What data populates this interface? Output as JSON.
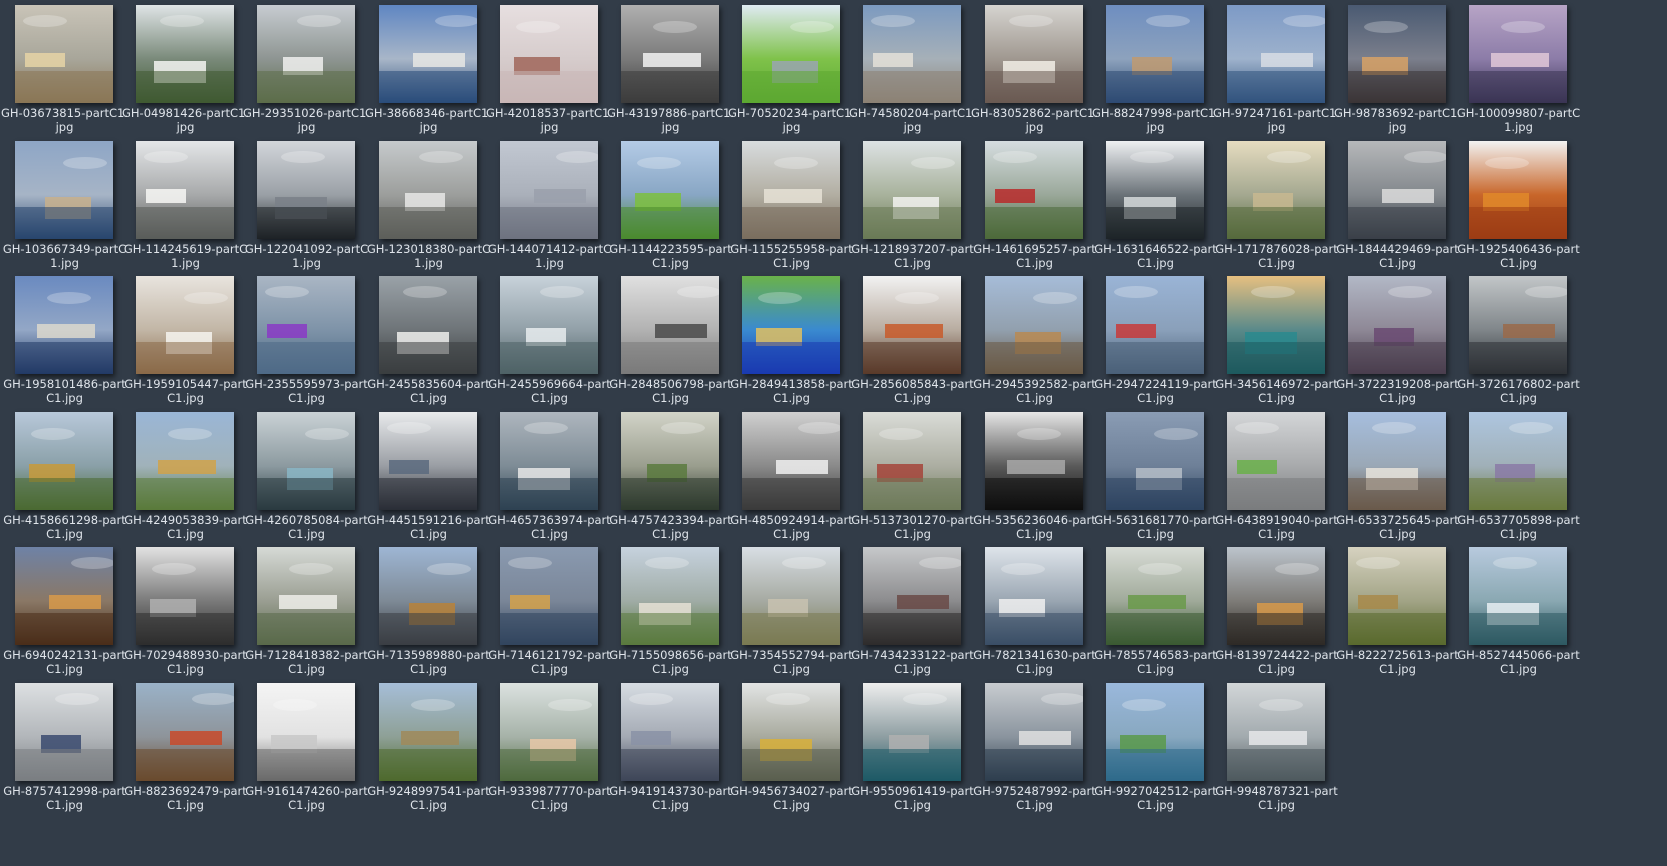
{
  "window": {
    "view": "thumbnail-grid"
  },
  "files": [
    {
      "name": "GH-03673815-partC1.jpg",
      "icon": "image-thumbnail",
      "sky": "#c9c4b8",
      "ground": "#8a7656",
      "accent": "#e6d3a6",
      "mid": "#a8a69a"
    },
    {
      "name": "GH-04981426-partC1.jpg",
      "icon": "image-thumbnail",
      "sky": "#dfe4e6",
      "ground": "#3f5a32",
      "accent": "#f4f4f2",
      "mid": "#7a8a7a"
    },
    {
      "name": "GH-29351026-partC1.jpg",
      "icon": "image-thumbnail",
      "sky": "#c7ccd1",
      "ground": "#5c6d4a",
      "accent": "#f0f0ee",
      "mid": "#8e9592"
    },
    {
      "name": "GH-38668346-partC1.jpg",
      "icon": "image-thumbnail",
      "sky": "#5f86c2",
      "ground": "#2a4c7a",
      "accent": "#e8e8e4",
      "mid": "#a8b6c8"
    },
    {
      "name": "GH-42018537-partC1.jpg",
      "icon": "image-thumbnail",
      "sky": "#e7dfe0",
      "ground": "#c9b7b6",
      "accent": "#a0665a",
      "mid": "#d6cccc"
    },
    {
      "name": "GH-43197886-partC1.jpg",
      "icon": "image-thumbnail",
      "sky": "#b0b0b0",
      "ground": "#3c3c3c",
      "accent": "#f2f2f2",
      "mid": "#7a7a7a"
    },
    {
      "name": "GH-70520234-partC1.jpg",
      "icon": "image-thumbnail",
      "sky": "#dfeaf2",
      "ground": "#5ca832",
      "accent": "#9aa4b2",
      "mid": "#7fc24a"
    },
    {
      "name": "GH-74580204-partC1.jpg",
      "icon": "image-thumbnail",
      "sky": "#7c9ac0",
      "ground": "#8c8274",
      "accent": "#e4e0d8",
      "mid": "#a6b0b8"
    },
    {
      "name": "GH-83052862-partC1.jpg",
      "icon": "image-thumbnail",
      "sky": "#d6d4d0",
      "ground": "#6a5a52",
      "accent": "#f2eee6",
      "mid": "#a09890"
    },
    {
      "name": "GH-88247998-partC1.jpg",
      "icon": "image-thumbnail",
      "sky": "#6e8ec0",
      "ground": "#2e4a72",
      "accent": "#c09a70",
      "mid": "#8da2bd"
    },
    {
      "name": "GH-97247161-partC1.jpg",
      "icon": "image-thumbnail",
      "sky": "#7d9ac6",
      "ground": "#32537e",
      "accent": "#d8dde4",
      "mid": "#9eb2cc"
    },
    {
      "name": "GH-98783692-partC1.jpg",
      "icon": "image-thumbnail",
      "sky": "#4a5a72",
      "ground": "#3b3436",
      "accent": "#d8a266",
      "mid": "#7b7f8c"
    },
    {
      "name": "GH-100099807-partC1.jpg",
      "icon": "image-thumbnail",
      "sky": "#b7a4c6",
      "ground": "#3a3454",
      "accent": "#e2c8d8",
      "mid": "#8c7ca8"
    },
    {
      "name": "GH-103667349-partC1.jpg",
      "icon": "image-thumbnail",
      "sky": "#8ea6c6",
      "ground": "#28466e",
      "accent": "#c8b08c",
      "mid": "#a6b4c6"
    },
    {
      "name": "GH-114245619-partC1.jpg",
      "icon": "image-thumbnail",
      "sky": "#e4e6e8",
      "ground": "#5a5c5a",
      "accent": "#f7f7f5",
      "mid": "#a7a9aa"
    },
    {
      "name": "GH-122041092-partC1.jpg",
      "icon": "image-thumbnail",
      "sky": "#d2d6da",
      "ground": "#1e2226",
      "accent": "#7a8088",
      "mid": "#9aa0a6"
    },
    {
      "name": "GH-123018380-partC1.jpg",
      "icon": "image-thumbnail",
      "sky": "#c6cacc",
      "ground": "#5c5e5a",
      "accent": "#e8e8e6",
      "mid": "#9c9e9c"
    },
    {
      "name": "GH-144071412-partC1.jpg",
      "icon": "image-thumbnail",
      "sky": "#c2c8d2",
      "ground": "#6e7280",
      "accent": "#9aa0ac",
      "mid": "#aab0ba"
    },
    {
      "name": "GH-1144223595-partC1.jpg",
      "icon": "image-thumbnail",
      "sky": "#b4cbe6",
      "ground": "#4a8a2e",
      "accent": "#7cbf3e",
      "mid": "#88a6c4"
    },
    {
      "name": "GH-1155255958-partC1.jpg",
      "icon": "image-thumbnail",
      "sky": "#d8dcde",
      "ground": "#7a6e5e",
      "accent": "#e6e2d6",
      "mid": "#b2aea2"
    },
    {
      "name": "GH-1218937207-partC1.jpg",
      "icon": "image-thumbnail",
      "sky": "#dde2e4",
      "ground": "#6a7a56",
      "accent": "#f2f2f0",
      "mid": "#a8b29c"
    },
    {
      "name": "GH-1461695257-partC1.jpg",
      "icon": "image-thumbnail",
      "sky": "#d6dde0",
      "ground": "#4d6a3a",
      "accent": "#b82a2a",
      "mid": "#9aa89a"
    },
    {
      "name": "GH-1631646522-partC1.jpg",
      "icon": "image-thumbnail",
      "sky": "#eef0f2",
      "ground": "#1e2428",
      "accent": "#d6dadc",
      "mid": "#6a7278"
    },
    {
      "name": "GH-1717876028-partC1.jpg",
      "icon": "image-thumbnail",
      "sky": "#e6dcc0",
      "ground": "#556a3c",
      "accent": "#c8b890",
      "mid": "#a4a890"
    },
    {
      "name": "GH-1844429469-partC1.jpg",
      "icon": "image-thumbnail",
      "sky": "#b6b8ba",
      "ground": "#3a4048",
      "accent": "#dcdcdc",
      "mid": "#82878c"
    },
    {
      "name": "GH-1925406436-partC1.jpg",
      "icon": "image-thumbnail",
      "sky": "#f2f2f2",
      "ground": "#9c3c14",
      "accent": "#e08a2a",
      "mid": "#c8662a"
    },
    {
      "name": "GH-1958101486-partC1.jpg",
      "icon": "image-thumbnail",
      "sky": "#6a8ac0",
      "ground": "#223a66",
      "accent": "#dcd8cc",
      "mid": "#93a7c6"
    },
    {
      "name": "GH-1959105447-partC1.jpg",
      "icon": "image-thumbnail",
      "sky": "#e8e4de",
      "ground": "#8a6a48",
      "accent": "#f6f4f0",
      "mid": "#c2b6a6"
    },
    {
      "name": "GH-2355595973-partC1.jpg",
      "icon": "image-thumbnail",
      "sky": "#aab6c4",
      "ground": "#4e6a86",
      "accent": "#8a3ac6",
      "mid": "#7e93a8"
    },
    {
      "name": "GH-2455835604-partC1.jpg",
      "icon": "image-thumbnail",
      "sky": "#9aa2a8",
      "ground": "#3a3e40",
      "accent": "#eeeeec",
      "mid": "#6e7478"
    },
    {
      "name": "GH-2455969664-partC1.jpg",
      "icon": "image-thumbnail",
      "sky": "#c8d2da",
      "ground": "#4e6266",
      "accent": "#e8ecee",
      "mid": "#92a0a8"
    },
    {
      "name": "GH-2848506798-partC1.jpg",
      "icon": "image-thumbnail",
      "sky": "#e0e0e0",
      "ground": "#7a7a7a",
      "accent": "#4a4a4a",
      "mid": "#b2b2b2"
    },
    {
      "name": "GH-2849413858-partC1.jpg",
      "icon": "image-thumbnail",
      "sky": "#6ab24a",
      "ground": "#1a3ab0",
      "accent": "#e0c060",
      "mid": "#3a8ad0"
    },
    {
      "name": "GH-2856085843-partC1.jpg",
      "icon": "image-thumbnail",
      "sky": "#f2f2f2",
      "ground": "#5a3a2a",
      "accent": "#c85a2a",
      "mid": "#b8aca0"
    },
    {
      "name": "GH-2945392582-partC1.jpg",
      "icon": "image-thumbnail",
      "sky": "#a6bcd8",
      "ground": "#6a5a46",
      "accent": "#b88a52",
      "mid": "#92a0ae"
    },
    {
      "name": "GH-2947224119-partC1.jpg",
      "icon": "image-thumbnail",
      "sky": "#9ab4d6",
      "ground": "#4a6078",
      "accent": "#c83a3a",
      "mid": "#8aa0ba"
    },
    {
      "name": "GH-3456146972-partC1.jpg",
      "icon": "image-thumbnail",
      "sky": "#e6c080",
      "ground": "#1e5a5e",
      "accent": "#2a8a8e",
      "mid": "#5a8a8a"
    },
    {
      "name": "GH-3722319208-partC1.jpg",
      "icon": "image-thumbnail",
      "sky": "#b2b8c6",
      "ground": "#4a3e4e",
      "accent": "#6a4a72",
      "mid": "#8e8896"
    },
    {
      "name": "GH-3726176802-partC1.jpg",
      "icon": "image-thumbnail",
      "sky": "#c2c6c8",
      "ground": "#2e3236",
      "accent": "#9a6a4a",
      "mid": "#80868a"
    },
    {
      "name": "GH-4158661298-partC1.jpg",
      "icon": "image-thumbnail",
      "sky": "#b8c8da",
      "ground": "#4a6a32",
      "accent": "#c89a3a",
      "mid": "#8aa0a8"
    },
    {
      "name": "GH-4249053839-partC1.jpg",
      "icon": "image-thumbnail",
      "sky": "#9ab6d6",
      "ground": "#5a7a3a",
      "accent": "#d0a24a",
      "mid": "#a0b2ba"
    },
    {
      "name": "GH-4260785084-partC1.jpg",
      "icon": "image-thumbnail",
      "sky": "#cad2d6",
      "ground": "#2a3a40",
      "accent": "#8ab6c6",
      "mid": "#8c9aa0"
    },
    {
      "name": "GH-4451591216-partC1.jpg",
      "icon": "image-thumbnail",
      "sky": "#e8eaec",
      "ground": "#2a2e36",
      "accent": "#5a6a7e",
      "mid": "#9a9ea4"
    },
    {
      "name": "GH-4657363974-partC1.jpg",
      "icon": "image-thumbnail",
      "sky": "#aeb6be",
      "ground": "#2e4252",
      "accent": "#e8e8e8",
      "mid": "#7e8c96"
    },
    {
      "name": "GH-4757423394-partC1.jpg",
      "icon": "image-thumbnail",
      "sky": "#d2d4c8",
      "ground": "#2e3a2e",
      "accent": "#5a7a3e",
      "mid": "#9a9e8e"
    },
    {
      "name": "GH-4850924914-partC1.jpg",
      "icon": "image-thumbnail",
      "sky": "#d0d0d0",
      "ground": "#3a3a3a",
      "accent": "#f0f0f0",
      "mid": "#8a8a8a"
    },
    {
      "name": "GH-5137301270-partC1.jpg",
      "icon": "image-thumbnail",
      "sky": "#dadcd8",
      "ground": "#6e7a5a",
      "accent": "#a4443a",
      "mid": "#acaea2"
    },
    {
      "name": "GH-5356236046-partC1.jpg",
      "icon": "image-thumbnail",
      "sky": "#e6e6e6",
      "ground": "#0e0e0e",
      "accent": "#a8a8a8",
      "mid": "#5a5a5a"
    },
    {
      "name": "GH-5631681770-partC1.jpg",
      "icon": "image-thumbnail",
      "sky": "#8a9cb4",
      "ground": "#2e4460",
      "accent": "#b6bec8",
      "mid": "#6e8098"
    },
    {
      "name": "GH-6438919040-partC1.jpg",
      "icon": "image-thumbnail",
      "sky": "#d4d6d8",
      "ground": "#7a7c7e",
      "accent": "#6ab04a",
      "mid": "#a8aaac"
    },
    {
      "name": "GH-6533725645-partC1.jpg",
      "icon": "image-thumbnail",
      "sky": "#a6bede",
      "ground": "#6a5a4a",
      "accent": "#e8e4dc",
      "mid": "#9aa8b6"
    },
    {
      "name": "GH-6537705898-partC1.jpg",
      "icon": "image-thumbnail",
      "sky": "#aec6e0",
      "ground": "#6a7a3e",
      "accent": "#8a7aa6",
      "mid": "#a0b0b8"
    },
    {
      "name": "GH-6940242131-partC1.jpg",
      "icon": "image-thumbnail",
      "sky": "#6e82a6",
      "ground": "#4a2e1a",
      "accent": "#d89a4a",
      "mid": "#8a7866"
    },
    {
      "name": "GH-7029488930-partC1.jpg",
      "icon": "image-thumbnail",
      "sky": "#e2e2e2",
      "ground": "#2e2e2e",
      "accent": "#b0b0b0",
      "mid": "#7a7a7a"
    },
    {
      "name": "GH-7128418382-partC1.jpg",
      "icon": "image-thumbnail",
      "sky": "#d6dad6",
      "ground": "#5a6a4a",
      "accent": "#eeeeea",
      "mid": "#9a9e92"
    },
    {
      "name": "GH-7135989880-partC1.jpg",
      "icon": "image-thumbnail",
      "sky": "#9eb6d4",
      "ground": "#3a3e44",
      "accent": "#b8823a",
      "mid": "#7e8a96"
    },
    {
      "name": "GH-7146121792-partC1.jpg",
      "icon": "image-thumbnail",
      "sky": "#8a9ab0",
      "ground": "#32455e",
      "accent": "#d6a24a",
      "mid": "#7a8698"
    },
    {
      "name": "GH-7155098656-partC1.jpg",
      "icon": "image-thumbnail",
      "sky": "#c6d2de",
      "ground": "#5a7a3e",
      "accent": "#e6e2d6",
      "mid": "#a0aca6"
    },
    {
      "name": "GH-7354552794-partC1.jpg",
      "icon": "image-thumbnail",
      "sky": "#d8dee4",
      "ground": "#7a7a52",
      "accent": "#c8c2b0",
      "mid": "#a6aaa2"
    },
    {
      "name": "GH-7434233122-partC1.jpg",
      "icon": "image-thumbnail",
      "sky": "#c6c8ca",
      "ground": "#2e2c2c",
      "accent": "#6a4a46",
      "mid": "#8c8c8e"
    },
    {
      "name": "GH-7821341630-partC1.jpg",
      "icon": "image-thumbnail",
      "sky": "#dee4ea",
      "ground": "#3a4e66",
      "accent": "#f0f0f0",
      "mid": "#9aa6b2"
    },
    {
      "name": "GH-7855746583-partC1.jpg",
      "icon": "image-thumbnail",
      "sky": "#d8dcd6",
      "ground": "#3a5a32",
      "accent": "#6a9a4a",
      "mid": "#a0aa9a"
    },
    {
      "name": "GH-8139724422-partC1.jpg",
      "icon": "image-thumbnail",
      "sky": "#bcc4cc",
      "ground": "#2e2a26",
      "accent": "#d89a4a",
      "mid": "#7e7c78"
    },
    {
      "name": "GH-8222725613-partC1.jpg",
      "icon": "image-thumbnail",
      "sky": "#d6d2c0",
      "ground": "#5a6a2e",
      "accent": "#a88a4a",
      "mid": "#a2a486"
    },
    {
      "name": "GH-8527445066-partC1.jpg",
      "icon": "image-thumbnail",
      "sky": "#b8cade",
      "ground": "#2e5a62",
      "accent": "#e8eef2",
      "mid": "#8aa8b2"
    },
    {
      "name": "GH-8757412998-partC1.jpg",
      "icon": "image-thumbnail",
      "sky": "#dde0e2",
      "ground": "#7a7e82",
      "accent": "#3a4a6e",
      "mid": "#b2b6ba"
    },
    {
      "name": "GH-8823692479-partC1.jpg",
      "icon": "image-thumbnail",
      "sky": "#9ab2c8",
      "ground": "#6a4a2e",
      "accent": "#c84a2a",
      "mid": "#8e949a"
    },
    {
      "name": "GH-9161474260-partC1.jpg",
      "icon": "image-thumbnail",
      "sky": "#f4f4f4",
      "ground": "#6a6a6a",
      "accent": "#c8c8c8",
      "mid": "#e2e2e2"
    },
    {
      "name": "GH-9248997541-partC1.jpg",
      "icon": "image-thumbnail",
      "sky": "#a6bed8",
      "ground": "#4e6a2e",
      "accent": "#a08a5a",
      "mid": "#8ea096"
    },
    {
      "name": "GH-9339877770-partC1.jpg",
      "icon": "image-thumbnail",
      "sky": "#dce2e0",
      "ground": "#4e6a3e",
      "accent": "#e8c8a8",
      "mid": "#a6b2a8"
    },
    {
      "name": "GH-9419143730-partC1.jpg",
      "icon": "image-thumbnail",
      "sky": "#d6dce2",
      "ground": "#3e4658",
      "accent": "#8a92a6",
      "mid": "#a4aab4"
    },
    {
      "name": "GH-9456734027-partC1.jpg",
      "icon": "image-thumbnail",
      "sky": "#e2e4e4",
      "ground": "#5a5e4e",
      "accent": "#d8b03a",
      "mid": "#a8aa9e"
    },
    {
      "name": "GH-9550961419-partC1.jpg",
      "icon": "image-thumbnail",
      "sky": "#eeeeee",
      "ground": "#1e5a66",
      "accent": "#b0b0b0",
      "mid": "#8e9ea2"
    },
    {
      "name": "GH-9752487992-partC1.jpg",
      "icon": "image-thumbnail",
      "sky": "#c8ccd0",
      "ground": "#2e3e4e",
      "accent": "#e0e0e0",
      "mid": "#8a949e"
    },
    {
      "name": "GH-9927042512-partC1.jpg",
      "icon": "image-thumbnail",
      "sky": "#9ab8dc",
      "ground": "#2e6a8a",
      "accent": "#5a9a4a",
      "mid": "#88a8c0"
    },
    {
      "name": "GH-9948787321-partC1.jpg",
      "icon": "image-thumbnail",
      "sky": "#d2d6d8",
      "ground": "#4e5a5e",
      "accent": "#e6e8ea",
      "mid": "#a2aaae"
    }
  ]
}
